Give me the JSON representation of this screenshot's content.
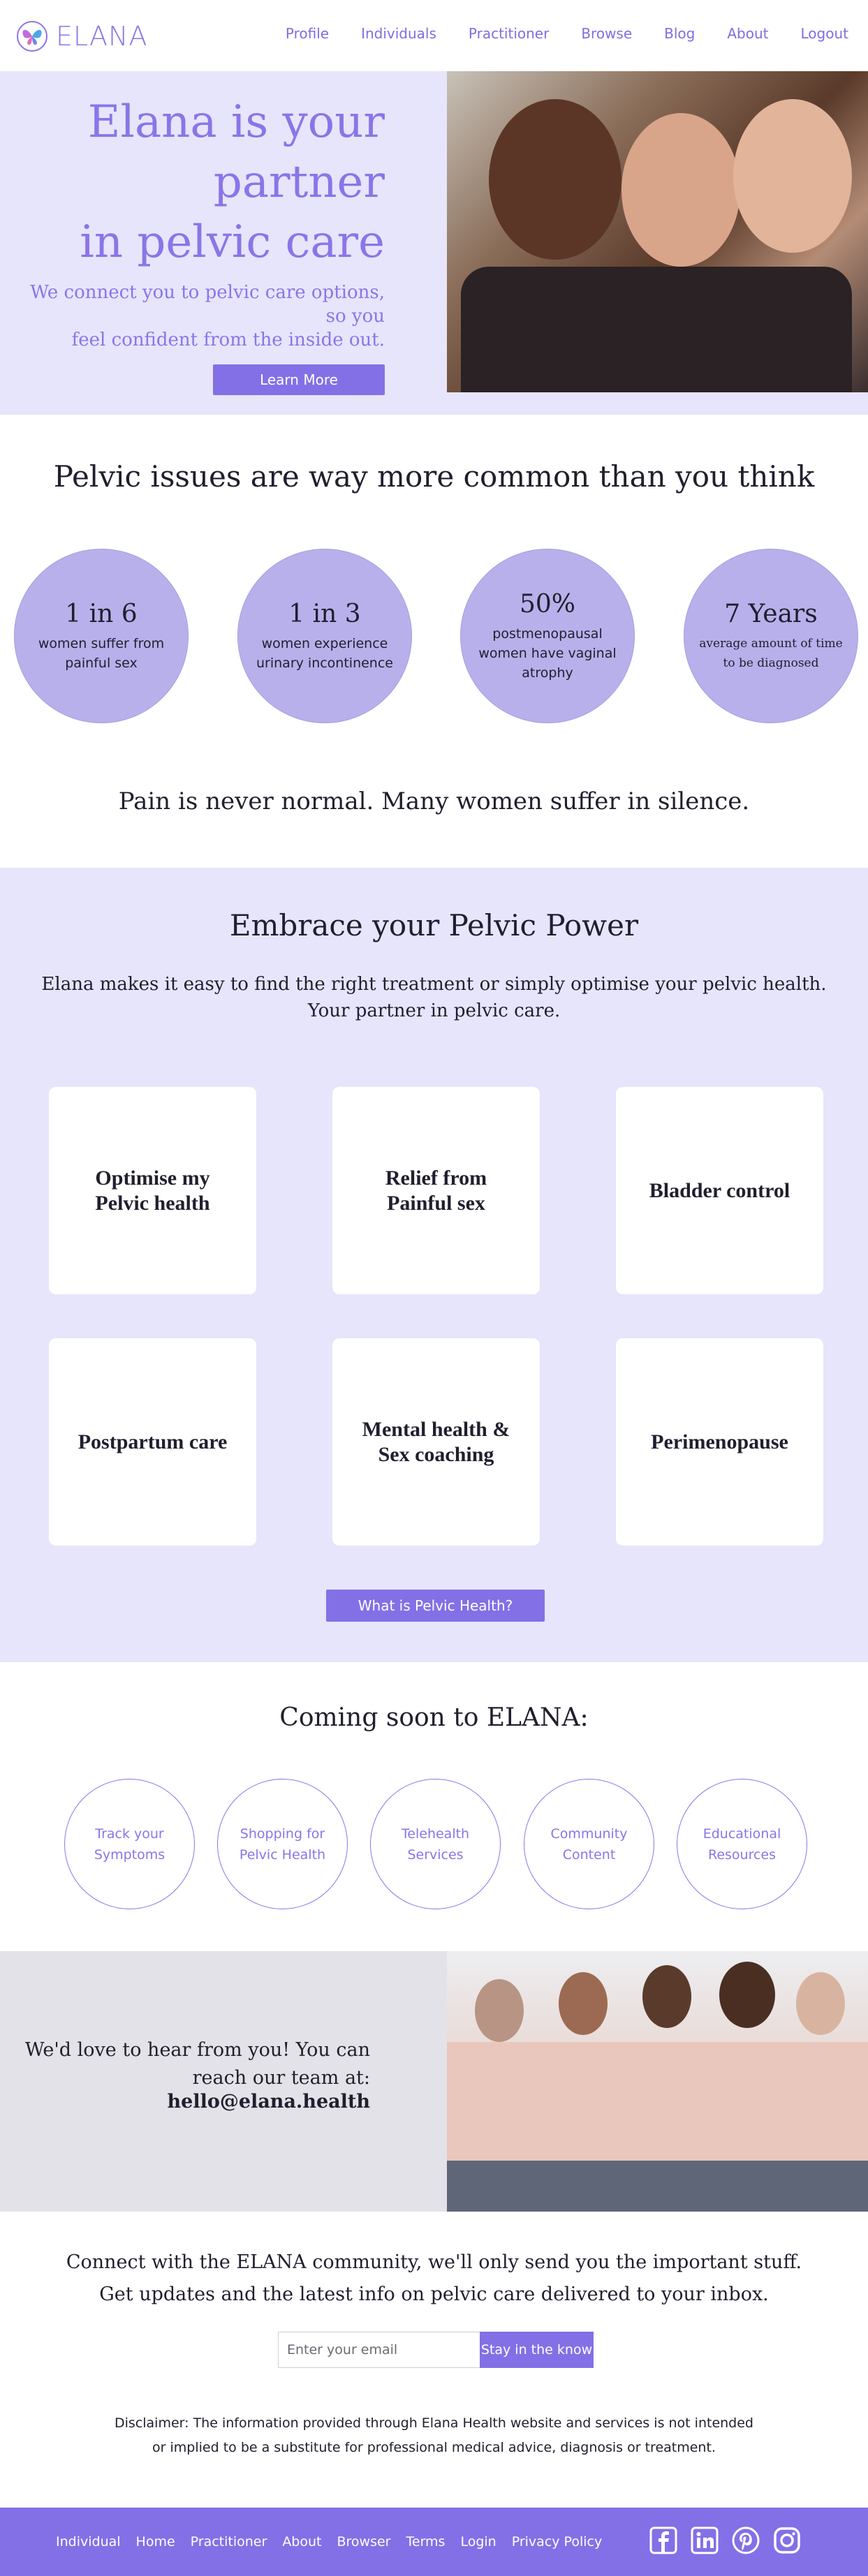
{
  "nav": {
    "logo_text": "ELANA",
    "links": [
      "Profile",
      "Individuals",
      "Practitioner",
      "Browse",
      "Blog",
      "About",
      "Logout"
    ]
  },
  "hero": {
    "title_line1": "Elana is your",
    "title_line2": "partner",
    "title_line3": "in pelvic care",
    "sub_line1": "We connect you to pelvic care options,",
    "sub_line2": "so you",
    "sub_line3": "feel confident from the inside out.",
    "button": "Learn More"
  },
  "stats": {
    "title": "Pelvic issues are way more common than you think",
    "items": [
      {
        "num": "1 in 6",
        "desc": "women suffer from painful sex"
      },
      {
        "num": "1 in 3",
        "desc": "women experience urinary incontinence"
      },
      {
        "num": "50%",
        "desc": "postmenopausal women have vaginal atrophy"
      },
      {
        "num": "7 Years",
        "desc": "average amount of time to be diagnosed"
      }
    ],
    "tagline": "Pain is never normal. Many women suffer in silence."
  },
  "embrace": {
    "title": "Embrace your Pelvic Power",
    "sub_line1": "Elana makes it easy to find the right treatment or simply optimise your pelvic health.",
    "sub_line2": "Your partner in pelvic care.",
    "cards": [
      "Optimise my Pelvic health",
      "Relief from Painful sex",
      "Bladder control",
      "Postpartum care",
      "Mental health & Sex coaching",
      "Perimenopause"
    ],
    "button": "What is Pelvic Health?"
  },
  "soon": {
    "title": "Coming soon to ELANA:",
    "items": [
      "Track your Symptoms",
      "Shopping for Pelvic Health",
      "Telehealth Services",
      "Community Content",
      "Educational Resources"
    ]
  },
  "contact": {
    "line1": "We'd love to hear from you! You can",
    "line2": "reach our team at:",
    "email": "hello@elana.health"
  },
  "newsletter": {
    "line1": "Connect with the ELANA community, we'll only send you the important stuff.",
    "line2": "Get updates and the latest info on pelvic care delivered to your inbox.",
    "placeholder": "Enter your email",
    "button": "Stay in the know"
  },
  "disclaimer": {
    "line1": "Disclaimer: The information provided through Elana Health website and services is not intended",
    "line2": "or implied to be a substitute for professional medical advice, diagnosis or treatment."
  },
  "footer": {
    "links": [
      "Individual",
      "Home",
      "Practitioner",
      "About",
      "Browser",
      "Terms",
      "Login",
      "Privacy Policy"
    ],
    "social_icons": [
      "facebook-icon",
      "linkedin-icon",
      "pinterest-icon",
      "instagram-icon"
    ]
  },
  "colors": {
    "brand": "#8370e6",
    "hero_bg": "#e7e5fb",
    "stat_circle": "#b8b0ea",
    "contact_bg": "#e3e2e8"
  }
}
